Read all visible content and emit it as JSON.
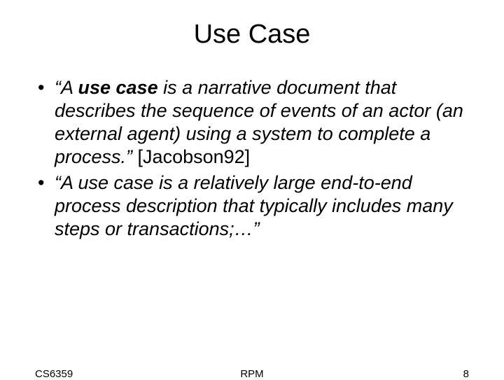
{
  "title": "Use Case",
  "bullets": [
    {
      "prefix": "“A ",
      "term": "use case",
      "rest": " is a narrative document that describes the sequence of events of an actor (an external agent) using a system to complete a process.” ",
      "citation": "[Jacobson92]"
    },
    {
      "full": "“A use case is a relatively large end-to-end process description that typically includes many steps or transactions;…”"
    }
  ],
  "footer": {
    "left": "CS6359",
    "center": "RPM",
    "right": "8"
  }
}
